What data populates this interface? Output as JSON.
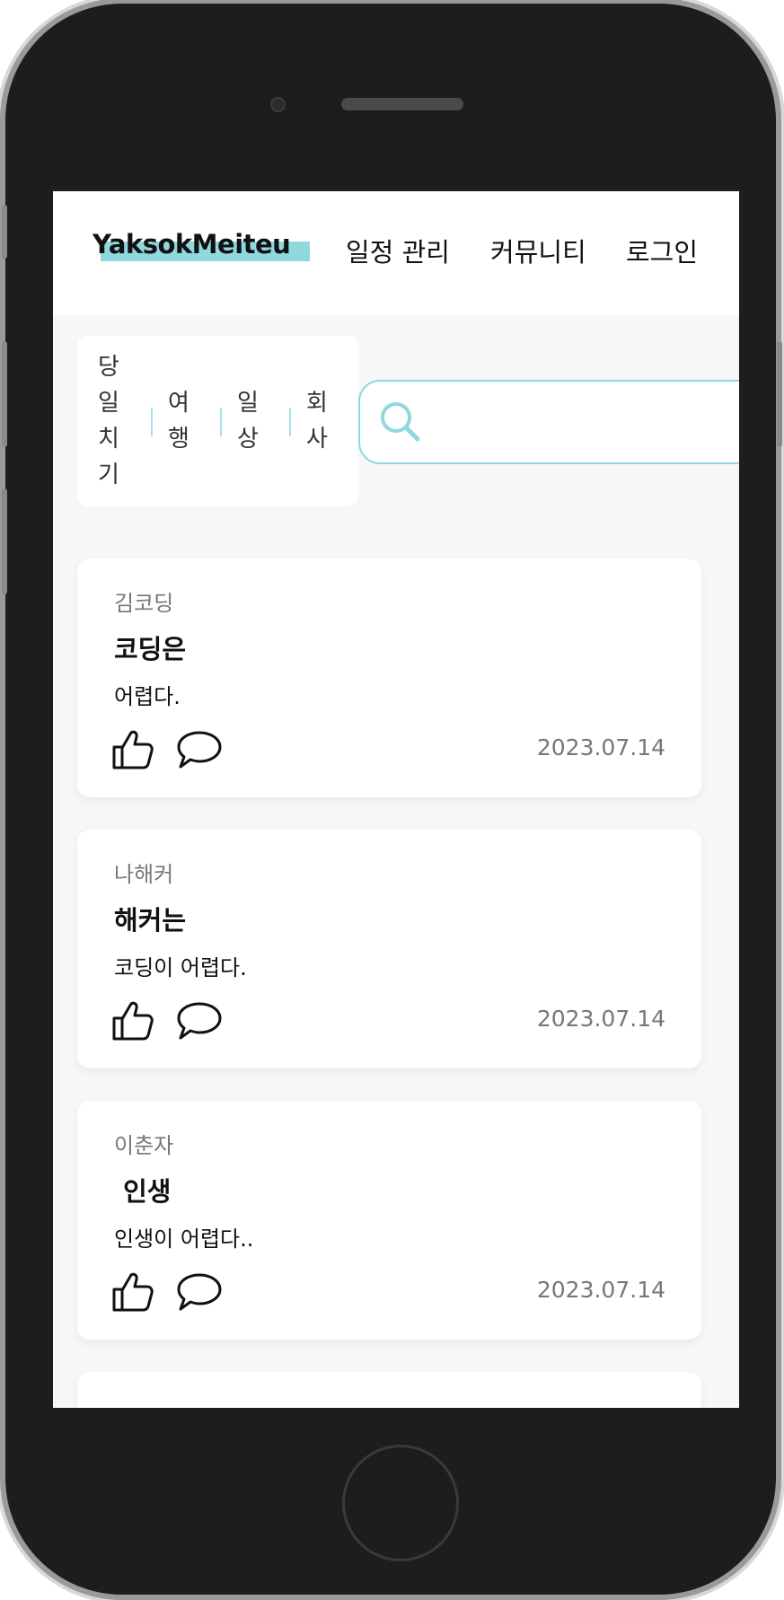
{
  "header": {
    "logo": "YaksokMeiteu",
    "nav": [
      "일정 관리",
      "커뮤니티",
      "로그인"
    ]
  },
  "categories": [
    {
      "label": "당일치기",
      "chars": [
        "당",
        "일",
        "치",
        "기"
      ]
    },
    {
      "label": "여행",
      "chars": [
        "여",
        "행"
      ]
    },
    {
      "label": "일상",
      "chars": [
        "일",
        "상"
      ]
    },
    {
      "label": "회사",
      "chars": [
        "회",
        "사"
      ]
    }
  ],
  "search": {
    "placeholder": ""
  },
  "posts": [
    {
      "author": "김코딩",
      "title": "코딩은",
      "body": "어렵다.",
      "date": "2023.07.14"
    },
    {
      "author": "나해커",
      "title": "해커는",
      "body": "코딩이 어렵다.",
      "date": "2023.07.14"
    },
    {
      "author": "이춘자",
      "title": " 인생",
      "body": "인생이 어렵다..",
      "date": "2023.07.14"
    }
  ],
  "colors": {
    "accent": "#8fd8de",
    "background": "#f7f7f7",
    "device": "#1d1d1d"
  }
}
